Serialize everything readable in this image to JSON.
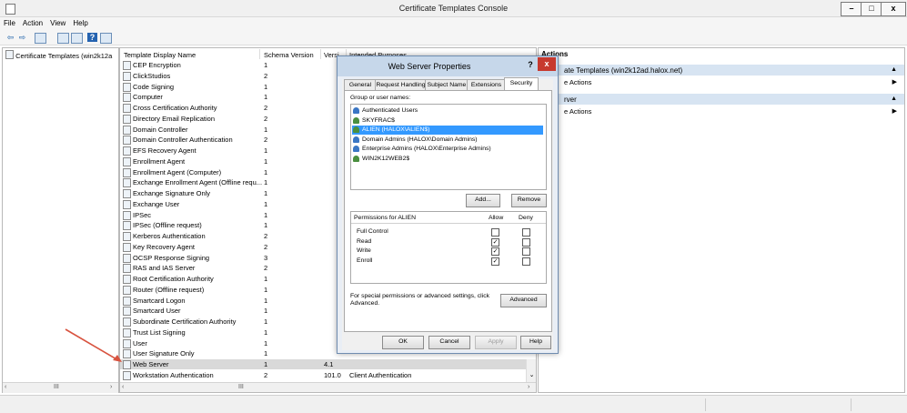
{
  "window": {
    "title": "Certificate Templates Console",
    "minimize": "–",
    "maximize": "□",
    "close": "x"
  },
  "menu": [
    "File",
    "Action",
    "View",
    "Help"
  ],
  "toolbar_icons": [
    "back-icon",
    "forward-icon",
    "console-tree-icon",
    "properties-icon",
    "export-icon",
    "help-icon",
    "show-hide-icon"
  ],
  "tree": {
    "root": "Certificate Templates (win2k12a"
  },
  "list": {
    "headers": [
      "Template Display Name",
      "Schema Version",
      "Versi...",
      "Intended Purposes"
    ],
    "rows": [
      {
        "name": "CEP Encryption",
        "schema": "1",
        "version": "",
        "purposes": ""
      },
      {
        "name": "ClickStudios",
        "schema": "2",
        "version": "",
        "purposes": ""
      },
      {
        "name": "Code Signing",
        "schema": "1",
        "version": "",
        "purposes": ""
      },
      {
        "name": "Computer",
        "schema": "1",
        "version": "",
        "purposes": ""
      },
      {
        "name": "Cross Certification Authority",
        "schema": "2",
        "version": "",
        "purposes": ""
      },
      {
        "name": "Directory Email Replication",
        "schema": "2",
        "version": "",
        "purposes": ""
      },
      {
        "name": "Domain Controller",
        "schema": "1",
        "version": "",
        "purposes": ""
      },
      {
        "name": "Domain Controller Authentication",
        "schema": "2",
        "version": "",
        "purposes": ""
      },
      {
        "name": "EFS Recovery Agent",
        "schema": "1",
        "version": "",
        "purposes": ""
      },
      {
        "name": "Enrollment Agent",
        "schema": "1",
        "version": "",
        "purposes": ""
      },
      {
        "name": "Enrollment Agent (Computer)",
        "schema": "1",
        "version": "",
        "purposes": ""
      },
      {
        "name": "Exchange Enrollment Agent (Offline requ...",
        "schema": "1",
        "version": "",
        "purposes": ""
      },
      {
        "name": "Exchange Signature Only",
        "schema": "1",
        "version": "",
        "purposes": ""
      },
      {
        "name": "Exchange User",
        "schema": "1",
        "version": "",
        "purposes": ""
      },
      {
        "name": "IPSec",
        "schema": "1",
        "version": "",
        "purposes": ""
      },
      {
        "name": "IPSec (Offline request)",
        "schema": "1",
        "version": "",
        "purposes": ""
      },
      {
        "name": "Kerberos Authentication",
        "schema": "2",
        "version": "",
        "purposes": ""
      },
      {
        "name": "Key Recovery Agent",
        "schema": "2",
        "version": "",
        "purposes": ""
      },
      {
        "name": "OCSP Response Signing",
        "schema": "3",
        "version": "",
        "purposes": ""
      },
      {
        "name": "RAS and IAS Server",
        "schema": "2",
        "version": "",
        "purposes": ""
      },
      {
        "name": "Root Certification Authority",
        "schema": "1",
        "version": "",
        "purposes": ""
      },
      {
        "name": "Router (Offline request)",
        "schema": "1",
        "version": "",
        "purposes": ""
      },
      {
        "name": "Smartcard Logon",
        "schema": "1",
        "version": "",
        "purposes": ""
      },
      {
        "name": "Smartcard User",
        "schema": "1",
        "version": "",
        "purposes": ""
      },
      {
        "name": "Subordinate Certification Authority",
        "schema": "1",
        "version": "",
        "purposes": ""
      },
      {
        "name": "Trust List Signing",
        "schema": "1",
        "version": "",
        "purposes": ""
      },
      {
        "name": "User",
        "schema": "1",
        "version": "",
        "purposes": ""
      },
      {
        "name": "User Signature Only",
        "schema": "1",
        "version": "",
        "purposes": ""
      },
      {
        "name": "Web Server",
        "schema": "1",
        "version": "4.1",
        "purposes": ""
      },
      {
        "name": "Workstation Authentication",
        "schema": "2",
        "version": "101.0",
        "purposes": "Client Authentication"
      }
    ],
    "selected_row": "Web Server"
  },
  "actions": {
    "header": "Actions",
    "section1_title": "ate Templates (win2k12ad.halox.net)",
    "section1_item": "e Actions",
    "section2_title": "rver",
    "section2_item": "e Actions"
  },
  "dialog": {
    "title": "Web Server Properties",
    "help": "?",
    "close": "x",
    "tabs": [
      "General",
      "Request Handling",
      "Subject Name",
      "Extensions",
      "Security"
    ],
    "active_tab": "Security",
    "group_label": "Group or user names:",
    "groups": [
      {
        "name": "Authenticated Users",
        "icon": "group-icon"
      },
      {
        "name": "SKYFRAC$",
        "icon": "user-icon"
      },
      {
        "name": "ALIEN (HALOX\\ALIEN$)",
        "icon": "user-icon"
      },
      {
        "name": "Domain Admins (HALOX\\Domain Admins)",
        "icon": "group-icon"
      },
      {
        "name": "Enterprise Admins (HALOX\\Enterprise Admins)",
        "icon": "group-icon"
      },
      {
        "name": "WIN2K12WEB2$",
        "icon": "user-icon"
      }
    ],
    "selected_group": "ALIEN (HALOX\\ALIEN$)",
    "add_button": "Add...",
    "remove_button": "Remove",
    "permissions_label": "Permissions for ALIEN",
    "allow_label": "Allow",
    "deny_label": "Deny",
    "permissions": [
      {
        "name": "Full Control",
        "allow": false,
        "deny": false
      },
      {
        "name": "Read",
        "allow": true,
        "deny": false
      },
      {
        "name": "Write",
        "allow": true,
        "deny": false
      },
      {
        "name": "Enroll",
        "allow": true,
        "deny": false
      }
    ],
    "special_text": "For special permissions or advanced settings, click Advanced.",
    "advanced_button": "Advanced",
    "ok_button": "OK",
    "cancel_button": "Cancel",
    "apply_button": "Apply",
    "help_button": "Help"
  },
  "scroll_thumb": "III",
  "colors": {
    "selection": "#3399ff",
    "arrow": "#d8533f",
    "dialog_close": "#c7392f"
  }
}
